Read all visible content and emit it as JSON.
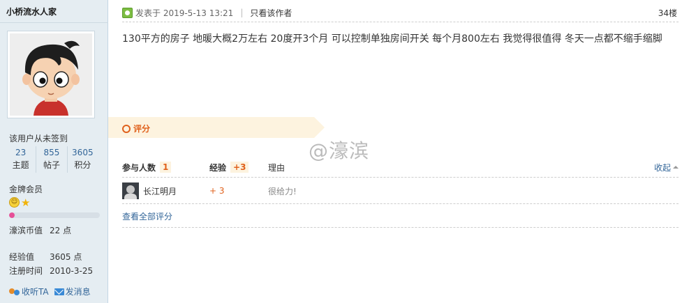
{
  "user": {
    "name": "小桥流水人家",
    "signin_status": "该用户从未签到",
    "stats": [
      {
        "value": "23",
        "label": "主题"
      },
      {
        "value": "855",
        "label": "帖子"
      },
      {
        "value": "3605",
        "label": "积分"
      }
    ],
    "group": "金牌会员",
    "level_progress_pct": 6,
    "currency": {
      "label": "濠滨币值",
      "value": "22 点"
    },
    "experience": {
      "label": "经验值",
      "value": "3605 点"
    },
    "registered": {
      "label": "注册时间",
      "value": "2010-3-25"
    },
    "actions": {
      "follow": "收听TA",
      "message": "发消息"
    }
  },
  "post": {
    "posted_at": "发表于 2019-5-13 13:21",
    "author_only": "只看该作者",
    "floor": "34楼",
    "content": "130平方的房子  地暖大概2万左右  20度开3个月  可以控制单独房间开关  每个月800左右  我觉得很值得  冬天一点都不缩手缩脚"
  },
  "rating": {
    "title": "评分",
    "col_participants": "参与人数",
    "participants_count": "1",
    "col_experience": "经验",
    "experience_total": "+3",
    "col_reason": "理由",
    "collapse": "收起",
    "rows": [
      {
        "name": "长江明月",
        "experience": "+ 3",
        "reason": "很给力!"
      }
    ],
    "view_all": "查看全部评分"
  },
  "watermark": "@濠滨",
  "colors": {
    "sidebar_bg": "#e5edf2",
    "accent_orange": "#e0611c",
    "link_blue": "#336699",
    "rate_banner_bg": "#fdf3df"
  }
}
